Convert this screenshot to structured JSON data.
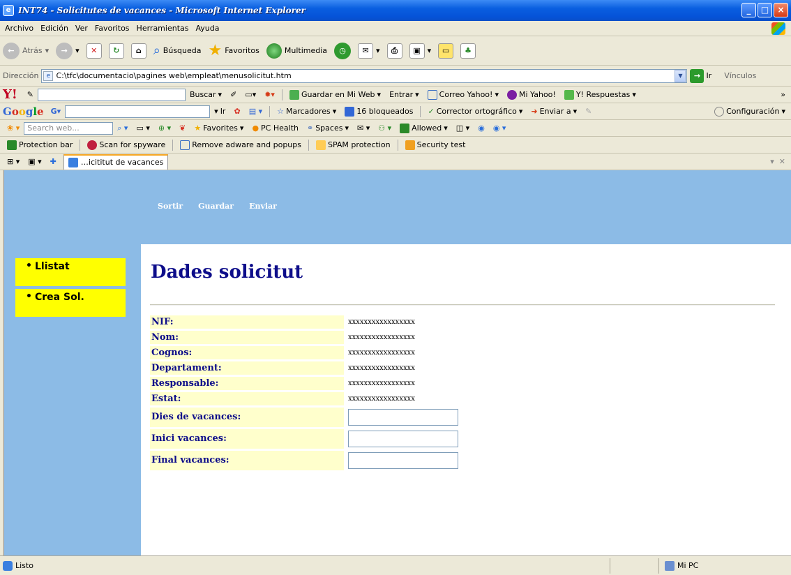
{
  "window": {
    "title": "INT74 - Solicitutes de vacances - Microsoft Internet Explorer",
    "app_icon": "ie-page-icon",
    "buttons": [
      "_",
      "□",
      "×"
    ]
  },
  "menubar": {
    "items": [
      "Archivo",
      "Edición",
      "Ver",
      "Favoritos",
      "Herramientas",
      "Ayuda"
    ]
  },
  "toolbar": {
    "back": "Atrás",
    "search": "Búsqueda",
    "favorites": "Favoritos",
    "multimedia": "Multimedia"
  },
  "address": {
    "label": "Dirección",
    "value": "C:\\tfc\\documentacio\\pagines web\\empleat\\menusolicitut.htm",
    "go": "Ir",
    "links": "Vínculos"
  },
  "yahoo_bar": {
    "buscar": "Buscar",
    "guardar": "Guardar en Mi Web",
    "entrar": "Entrar",
    "correo": "Correo Yahoo!",
    "mi_yahoo": "Mi Yahoo!",
    "respuestas": "Y! Respuestas"
  },
  "google_bar": {
    "ir": "Ir",
    "marcadores": "Marcadores",
    "bloqueados": "16 bloqueados",
    "corrector": "Corrector ortográfico",
    "enviar": "Enviar a",
    "configuracion": "Configuración"
  },
  "msn_bar": {
    "placeholder": "Search web...",
    "favorites": "Favorites",
    "pc_health": "PC Health",
    "spaces": "Spaces",
    "allowed": "Allowed"
  },
  "protection_bar": {
    "items": [
      "Protection bar",
      "Scan for spyware",
      "Remove adware and popups",
      "SPAM protection",
      "Security test"
    ]
  },
  "tab": {
    "label": "…icititut de vacances"
  },
  "page": {
    "nav": [
      "Sortir",
      "Guardar",
      "Enviar"
    ],
    "side": [
      "Llistat",
      "Crea Sol."
    ],
    "title": "Dades solicitut",
    "static_fields": [
      {
        "label": "NIF:",
        "value": "xxxxxxxxxxxxxxxxx"
      },
      {
        "label": "Nom:",
        "value": "xxxxxxxxxxxxxxxxx"
      },
      {
        "label": "Cognos:",
        "value": "xxxxxxxxxxxxxxxxx"
      },
      {
        "label": "Departament:",
        "value": "xxxxxxxxxxxxxxxxx"
      },
      {
        "label": "Responsable:",
        "value": "xxxxxxxxxxxxxxxxx"
      },
      {
        "label": "Estat:",
        "value": "xxxxxxxxxxxxxxxxx"
      }
    ],
    "input_fields": [
      {
        "label": "Dies de vacances:",
        "value": ""
      },
      {
        "label": "Inici vacances:",
        "value": ""
      },
      {
        "label": "Final vacances:",
        "value": ""
      }
    ]
  },
  "status": {
    "left": "Listo",
    "right": "Mi PC"
  },
  "colors": {
    "header_blue": "#8cbbe6",
    "nav_yellow": "#ffff00",
    "label_bg": "#ffffcc",
    "title_navy": "#0d0d8a"
  }
}
